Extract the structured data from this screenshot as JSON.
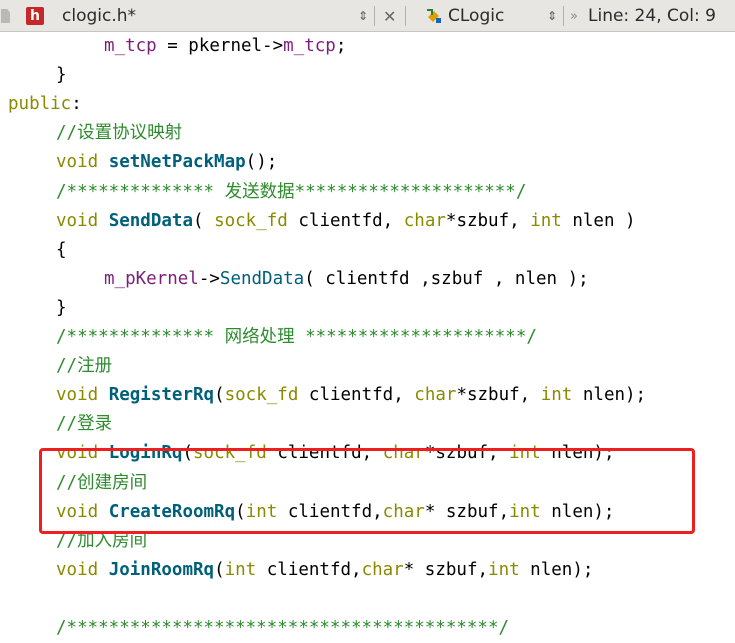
{
  "tab": {
    "filename": "clogic.h*",
    "file_icon": "h-file-icon"
  },
  "class_selector": {
    "label": "CLogic",
    "icon": "class-icon"
  },
  "status": {
    "position": "Line: 24, Col: 9"
  },
  "code_lines": [
    {
      "tokens": [
        [
          "mem",
          "m_tcp"
        ],
        [
          "plain",
          " = pkernel->"
        ],
        [
          "mem",
          "m_tcp"
        ],
        [
          "plain",
          ";"
        ]
      ],
      "indent": 8
    },
    {
      "tokens": [
        [
          "plain",
          "}"
        ]
      ],
      "indent": 4
    },
    {
      "tokens": [
        [
          "kw",
          "public"
        ],
        [
          "plain",
          ":"
        ]
      ],
      "indent": 0
    },
    {
      "tokens": [
        [
          "cm",
          "//设置协议映射"
        ]
      ],
      "indent": 4
    },
    {
      "tokens": [
        [
          "tp",
          "void"
        ],
        [
          "plain",
          " "
        ],
        [
          "fn",
          "setNetPackMap"
        ],
        [
          "plain",
          "();"
        ]
      ],
      "indent": 4
    },
    {
      "tokens": [
        [
          "cm",
          "/************** 发送数据*********************/"
        ]
      ],
      "indent": 4
    },
    {
      "tokens": [
        [
          "tp",
          "void"
        ],
        [
          "plain",
          " "
        ],
        [
          "fn",
          "SendData"
        ],
        [
          "plain",
          "( "
        ],
        [
          "tp",
          "sock_fd"
        ],
        [
          "plain",
          " clientfd, "
        ],
        [
          "tp",
          "char"
        ],
        [
          "plain",
          "*szbuf, "
        ],
        [
          "tp",
          "int"
        ],
        [
          "plain",
          " nlen )"
        ]
      ],
      "indent": 4
    },
    {
      "tokens": [
        [
          "plain",
          "{"
        ]
      ],
      "indent": 4
    },
    {
      "tokens": [
        [
          "mem",
          "m_pKernel"
        ],
        [
          "plain",
          "->"
        ],
        [
          "api",
          "SendData"
        ],
        [
          "plain",
          "( clientfd ,szbuf , nlen );"
        ]
      ],
      "indent": 8
    },
    {
      "tokens": [
        [
          "plain",
          "}"
        ]
      ],
      "indent": 4
    },
    {
      "tokens": [
        [
          "cm",
          "/************** 网络处理 *********************/"
        ]
      ],
      "indent": 4
    },
    {
      "tokens": [
        [
          "cm",
          "//注册"
        ]
      ],
      "indent": 4
    },
    {
      "tokens": [
        [
          "tp",
          "void"
        ],
        [
          "plain",
          " "
        ],
        [
          "fn",
          "RegisterRq"
        ],
        [
          "plain",
          "("
        ],
        [
          "tp",
          "sock_fd"
        ],
        [
          "plain",
          " clientfd, "
        ],
        [
          "tp",
          "char"
        ],
        [
          "plain",
          "*szbuf, "
        ],
        [
          "tp",
          "int"
        ],
        [
          "plain",
          " nlen);"
        ]
      ],
      "indent": 4
    },
    {
      "tokens": [
        [
          "cm",
          "//登录"
        ]
      ],
      "indent": 4
    },
    {
      "tokens": [
        [
          "tp",
          "void"
        ],
        [
          "plain",
          " "
        ],
        [
          "fn",
          "LoginRq"
        ],
        [
          "plain",
          "("
        ],
        [
          "tp",
          "sock_fd"
        ],
        [
          "plain",
          " clientfd, "
        ],
        [
          "tp",
          "char"
        ],
        [
          "plain",
          "*szbuf, "
        ],
        [
          "tp",
          "int"
        ],
        [
          "plain",
          " nlen);"
        ]
      ],
      "indent": 4
    },
    {
      "tokens": [
        [
          "cm",
          "//创建房间"
        ]
      ],
      "indent": 4
    },
    {
      "tokens": [
        [
          "tp",
          "void"
        ],
        [
          "plain",
          " "
        ],
        [
          "fn",
          "CreateRoomRq"
        ],
        [
          "plain",
          "("
        ],
        [
          "tp",
          "int"
        ],
        [
          "plain",
          " clientfd,"
        ],
        [
          "tp",
          "char"
        ],
        [
          "plain",
          "* szbuf,"
        ],
        [
          "tp",
          "int"
        ],
        [
          "plain",
          " nlen);"
        ]
      ],
      "indent": 4
    },
    {
      "tokens": [
        [
          "cm",
          "//加入房间"
        ]
      ],
      "indent": 4
    },
    {
      "tokens": [
        [
          "tp",
          "void"
        ],
        [
          "plain",
          " "
        ],
        [
          "fn",
          "JoinRoomRq"
        ],
        [
          "plain",
          "("
        ],
        [
          "tp",
          "int"
        ],
        [
          "plain",
          " clientfd,"
        ],
        [
          "tp",
          "char"
        ],
        [
          "plain",
          "* szbuf,"
        ],
        [
          "tp",
          "int"
        ],
        [
          "plain",
          " nlen);"
        ]
      ],
      "indent": 4
    },
    {
      "tokens": [
        [
          "plain",
          ""
        ]
      ],
      "indent": 0
    },
    {
      "tokens": [
        [
          "cm",
          "/*****************************************/"
        ]
      ],
      "indent": 4
    }
  ]
}
